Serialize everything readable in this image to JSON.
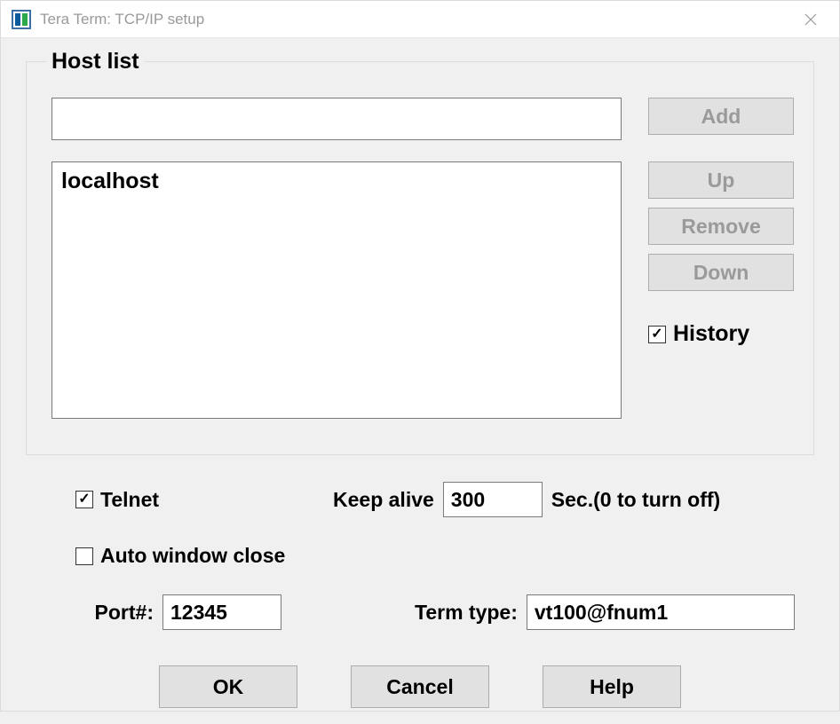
{
  "window": {
    "title": "Tera Term: TCP/IP setup"
  },
  "hostlist": {
    "legend": "Host list",
    "input_value": "",
    "items": [
      "localhost"
    ],
    "buttons": {
      "add": "Add",
      "up": "Up",
      "remove": "Remove",
      "down": "Down"
    },
    "history_label": "History",
    "history_checked": true
  },
  "options": {
    "telnet_label": "Telnet",
    "telnet_checked": true,
    "keepalive_label": "Keep alive",
    "keepalive_value": "300",
    "keepalive_suffix": "Sec.(0 to turn off)",
    "autoclose_label": "Auto window close",
    "autoclose_checked": false,
    "port_label": "Port#:",
    "port_value": "12345",
    "termtype_label": "Term type:",
    "termtype_value": "vt100@fnum1"
  },
  "footer": {
    "ok": "OK",
    "cancel": "Cancel",
    "help": "Help"
  }
}
